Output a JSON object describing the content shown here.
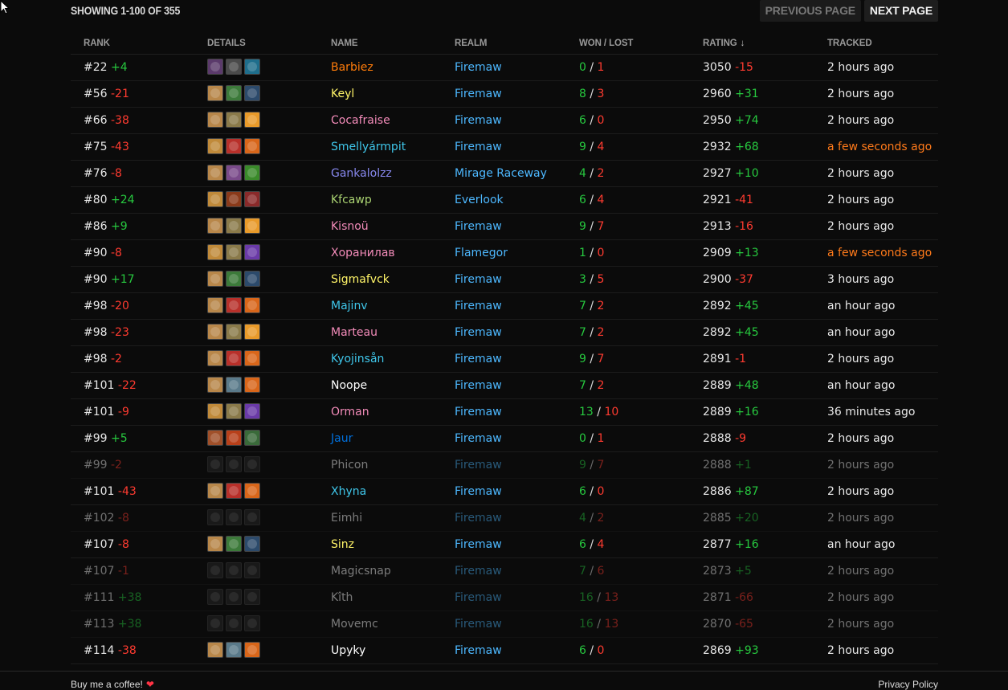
{
  "header": {
    "showing": "SHOWING 1-100 OF 355",
    "prev_label": "PREVIOUS PAGE",
    "next_label": "NEXT PAGE"
  },
  "columns": {
    "rank": "RANK",
    "details": "DETAILS",
    "name": "NAME",
    "realm": "REALM",
    "won_lost": "WON / LOST",
    "rating": "RATING",
    "tracked": "TRACKED",
    "sort_icon": "↓"
  },
  "colors": {
    "positive": "#27c93f",
    "negative": "#ff3b30",
    "realm": "#4db8ff",
    "recent": "#ff7a1a"
  },
  "rows": [
    {
      "rank": "#22",
      "rank_delta": "+4",
      "icons": [
        "#5b3a6b",
        "#4a4a4a",
        "#1f6e8c"
      ],
      "name": "Barbiez",
      "name_color": "#ff7c0a",
      "realm": "Firemaw",
      "won": "0",
      "lost": "1",
      "rating": "3050",
      "rating_delta": "-15",
      "tracked": "2 hours ago",
      "dim": false,
      "recent": false
    },
    {
      "rank": "#56",
      "rank_delta": "-21",
      "icons": [
        "#b8874a",
        "#3c7a3a",
        "#2c4a6b"
      ],
      "name": "Keyl",
      "name_color": "#fff468",
      "realm": "Firemaw",
      "won": "8",
      "lost": "3",
      "rating": "2960",
      "rating_delta": "+31",
      "tracked": "2 hours ago",
      "dim": false,
      "recent": false
    },
    {
      "rank": "#66",
      "rank_delta": "-38",
      "icons": [
        "#b8874a",
        "#8a7a4a",
        "#e89a2a"
      ],
      "name": "Cocafraise",
      "name_color": "#f48cba",
      "realm": "Firemaw",
      "won": "6",
      "lost": "0",
      "rating": "2950",
      "rating_delta": "+74",
      "tracked": "2 hours ago",
      "dim": false,
      "recent": false
    },
    {
      "rank": "#75",
      "rank_delta": "-43",
      "icons": [
        "#c08a3a",
        "#b8302a",
        "#d8661a"
      ],
      "name": "Smellyármpit",
      "name_color": "#3fc7eb",
      "realm": "Firemaw",
      "won": "9",
      "lost": "4",
      "rating": "2932",
      "rating_delta": "+68",
      "tracked": "a few seconds ago",
      "dim": false,
      "recent": true
    },
    {
      "rank": "#76",
      "rank_delta": "-8",
      "icons": [
        "#b8874a",
        "#7a4a8a",
        "#3a8a2a"
      ],
      "name": "Gankalolzz",
      "name_color": "#8788ee",
      "realm": "Mirage Raceway",
      "won": "4",
      "lost": "2",
      "rating": "2927",
      "rating_delta": "+10",
      "tracked": "2 hours ago",
      "dim": false,
      "recent": false
    },
    {
      "rank": "#80",
      "rank_delta": "+24",
      "icons": [
        "#c08a3a",
        "#8a3a1a",
        "#8a2a2a"
      ],
      "name": "Kfcawp",
      "name_color": "#aad372",
      "realm": "Everlook",
      "won": "6",
      "lost": "4",
      "rating": "2921",
      "rating_delta": "-41",
      "tracked": "2 hours ago",
      "dim": false,
      "recent": false
    },
    {
      "rank": "#86",
      "rank_delta": "+9",
      "icons": [
        "#b8874a",
        "#8a7a4a",
        "#e89a2a"
      ],
      "name": "Kisnoü",
      "name_color": "#f48cba",
      "realm": "Firemaw",
      "won": "9",
      "lost": "7",
      "rating": "2913",
      "rating_delta": "-16",
      "tracked": "2 hours ago",
      "dim": false,
      "recent": false
    },
    {
      "rank": "#90",
      "rank_delta": "-8",
      "icons": [
        "#c08a3a",
        "#8a7a4a",
        "#6a3aa8"
      ],
      "name": "Хоранилав",
      "name_color": "#f48cba",
      "realm": "Flamegor",
      "won": "1",
      "lost": "0",
      "rating": "2909",
      "rating_delta": "+13",
      "tracked": "a few seconds ago",
      "dim": false,
      "recent": true
    },
    {
      "rank": "#90",
      "rank_delta": "+17",
      "icons": [
        "#b8874a",
        "#3c7a3a",
        "#2c4a6b"
      ],
      "name": "Sigmafvck",
      "name_color": "#fff468",
      "realm": "Firemaw",
      "won": "3",
      "lost": "5",
      "rating": "2900",
      "rating_delta": "-37",
      "tracked": "3 hours ago",
      "dim": false,
      "recent": false
    },
    {
      "rank": "#98",
      "rank_delta": "-20",
      "icons": [
        "#b8874a",
        "#b8302a",
        "#d8661a"
      ],
      "name": "Majinv",
      "name_color": "#3fc7eb",
      "realm": "Firemaw",
      "won": "7",
      "lost": "2",
      "rating": "2892",
      "rating_delta": "+45",
      "tracked": "an hour ago",
      "dim": false,
      "recent": false
    },
    {
      "rank": "#98",
      "rank_delta": "-23",
      "icons": [
        "#b8874a",
        "#8a7a4a",
        "#e89a2a"
      ],
      "name": "Marteau",
      "name_color": "#f48cba",
      "realm": "Firemaw",
      "won": "7",
      "lost": "2",
      "rating": "2892",
      "rating_delta": "+45",
      "tracked": "an hour ago",
      "dim": false,
      "recent": false
    },
    {
      "rank": "#98",
      "rank_delta": "-2",
      "icons": [
        "#b8874a",
        "#b8302a",
        "#d8661a"
      ],
      "name": "Kyojinsån",
      "name_color": "#3fc7eb",
      "realm": "Firemaw",
      "won": "9",
      "lost": "7",
      "rating": "2891",
      "rating_delta": "-1",
      "tracked": "2 hours ago",
      "dim": false,
      "recent": false
    },
    {
      "rank": "#101",
      "rank_delta": "-22",
      "icons": [
        "#b8874a",
        "#5a7a8a",
        "#d8661a"
      ],
      "name": "Noope",
      "name_color": "#ffffff",
      "realm": "Firemaw",
      "won": "7",
      "lost": "2",
      "rating": "2889",
      "rating_delta": "+48",
      "tracked": "an hour ago",
      "dim": false,
      "recent": false
    },
    {
      "rank": "#101",
      "rank_delta": "-9",
      "icons": [
        "#c08a3a",
        "#8a7a4a",
        "#6a3aa8"
      ],
      "name": "Orman",
      "name_color": "#f48cba",
      "realm": "Firemaw",
      "won": "13",
      "lost": "10",
      "rating": "2889",
      "rating_delta": "+16",
      "tracked": "36 minutes ago",
      "dim": false,
      "recent": false
    },
    {
      "rank": "#99",
      "rank_delta": "+5",
      "icons": [
        "#a0502a",
        "#b8401a",
        "#3a6a3a"
      ],
      "name": "Jaur",
      "name_color": "#0070dd",
      "realm": "Firemaw",
      "won": "0",
      "lost": "1",
      "rating": "2888",
      "rating_delta": "-9",
      "tracked": "2 hours ago",
      "dim": false,
      "recent": false
    },
    {
      "rank": "#99",
      "rank_delta": "-2",
      "icons": [
        "#2a2a2a",
        "#2a2a2a",
        "#2a2a2a"
      ],
      "name": "Phicon",
      "name_color": "#ffffff",
      "realm": "Firemaw",
      "won": "9",
      "lost": "7",
      "rating": "2888",
      "rating_delta": "+1",
      "tracked": "2 hours ago",
      "dim": true,
      "recent": false
    },
    {
      "rank": "#101",
      "rank_delta": "-43",
      "icons": [
        "#b8874a",
        "#b8302a",
        "#d8661a"
      ],
      "name": "Xhyna",
      "name_color": "#3fc7eb",
      "realm": "Firemaw",
      "won": "6",
      "lost": "0",
      "rating": "2886",
      "rating_delta": "+87",
      "tracked": "2 hours ago",
      "dim": false,
      "recent": false
    },
    {
      "rank": "#102",
      "rank_delta": "-8",
      "icons": [
        "#2a2a2a",
        "#2a2a2a",
        "#2a2a2a"
      ],
      "name": "Eimhi",
      "name_color": "#ffffff",
      "realm": "Firemaw",
      "won": "4",
      "lost": "2",
      "rating": "2885",
      "rating_delta": "+20",
      "tracked": "2 hours ago",
      "dim": true,
      "recent": false
    },
    {
      "rank": "#107",
      "rank_delta": "-8",
      "icons": [
        "#b8874a",
        "#3c7a3a",
        "#2c4a6b"
      ],
      "name": "Sinz",
      "name_color": "#fff468",
      "realm": "Firemaw",
      "won": "6",
      "lost": "4",
      "rating": "2877",
      "rating_delta": "+16",
      "tracked": "an hour ago",
      "dim": false,
      "recent": false
    },
    {
      "rank": "#107",
      "rank_delta": "-1",
      "icons": [
        "#2a2a2a",
        "#2a2a2a",
        "#2a2a2a"
      ],
      "name": "Magicsnap",
      "name_color": "#ffffff",
      "realm": "Firemaw",
      "won": "7",
      "lost": "6",
      "rating": "2873",
      "rating_delta": "+5",
      "tracked": "2 hours ago",
      "dim": true,
      "recent": false
    },
    {
      "rank": "#111",
      "rank_delta": "+38",
      "icons": [
        "#2a2a2a",
        "#2a2a2a",
        "#2a2a2a"
      ],
      "name": "Kîth",
      "name_color": "#ffffff",
      "realm": "Firemaw",
      "won": "16",
      "lost": "13",
      "rating": "2871",
      "rating_delta": "-66",
      "tracked": "2 hours ago",
      "dim": true,
      "recent": false
    },
    {
      "rank": "#113",
      "rank_delta": "+38",
      "icons": [
        "#2a2a2a",
        "#2a2a2a",
        "#2a2a2a"
      ],
      "name": "Movemc",
      "name_color": "#ffffff",
      "realm": "Firemaw",
      "won": "16",
      "lost": "13",
      "rating": "2870",
      "rating_delta": "-65",
      "tracked": "2 hours ago",
      "dim": true,
      "recent": false
    },
    {
      "rank": "#114",
      "rank_delta": "-38",
      "icons": [
        "#b8874a",
        "#5a7a8a",
        "#d8661a"
      ],
      "name": "Upyky",
      "name_color": "#ffffff",
      "realm": "Firemaw",
      "won": "6",
      "lost": "0",
      "rating": "2869",
      "rating_delta": "+93",
      "tracked": "2 hours ago",
      "dim": false,
      "recent": false
    }
  ],
  "footer": {
    "coffee": "Buy me a coffee!",
    "heart": "❤",
    "privacy": "Privacy Policy"
  }
}
